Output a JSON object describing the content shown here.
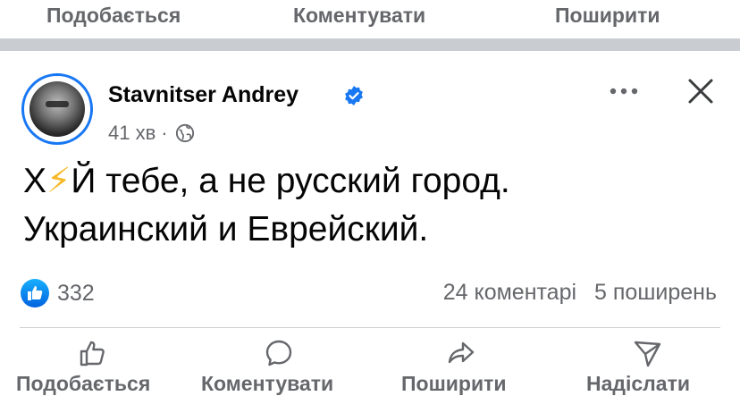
{
  "top_actions": {
    "like": "Подобається",
    "comment": "Коментувати",
    "share": "Поширити"
  },
  "post": {
    "author": "Stavnitser Andrey",
    "time": "41 хв",
    "dot": "·",
    "text_line1_a": "Х",
    "text_line1_emoji": "⚡",
    "text_line1_b": "Й тебе, а не русский город.",
    "text_line2": "Украинский и Еврейский.",
    "reactions_count": "332",
    "comments_count": "24 коментарі",
    "shares_count": "5 поширень"
  },
  "action_bar": {
    "like": "Подобається",
    "comment": "Коментувати",
    "share": "Поширити",
    "send": "Надіслати"
  },
  "colors": {
    "accent": "#1877f2",
    "secondary_text": "#65676b",
    "separator": "#c9ccd1"
  },
  "icons": [
    "verified-badge-icon",
    "globe-icon",
    "more-icon",
    "close-icon",
    "like-reaction-icon",
    "thumbs-up-icon",
    "comment-icon",
    "share-icon",
    "send-icon"
  ]
}
